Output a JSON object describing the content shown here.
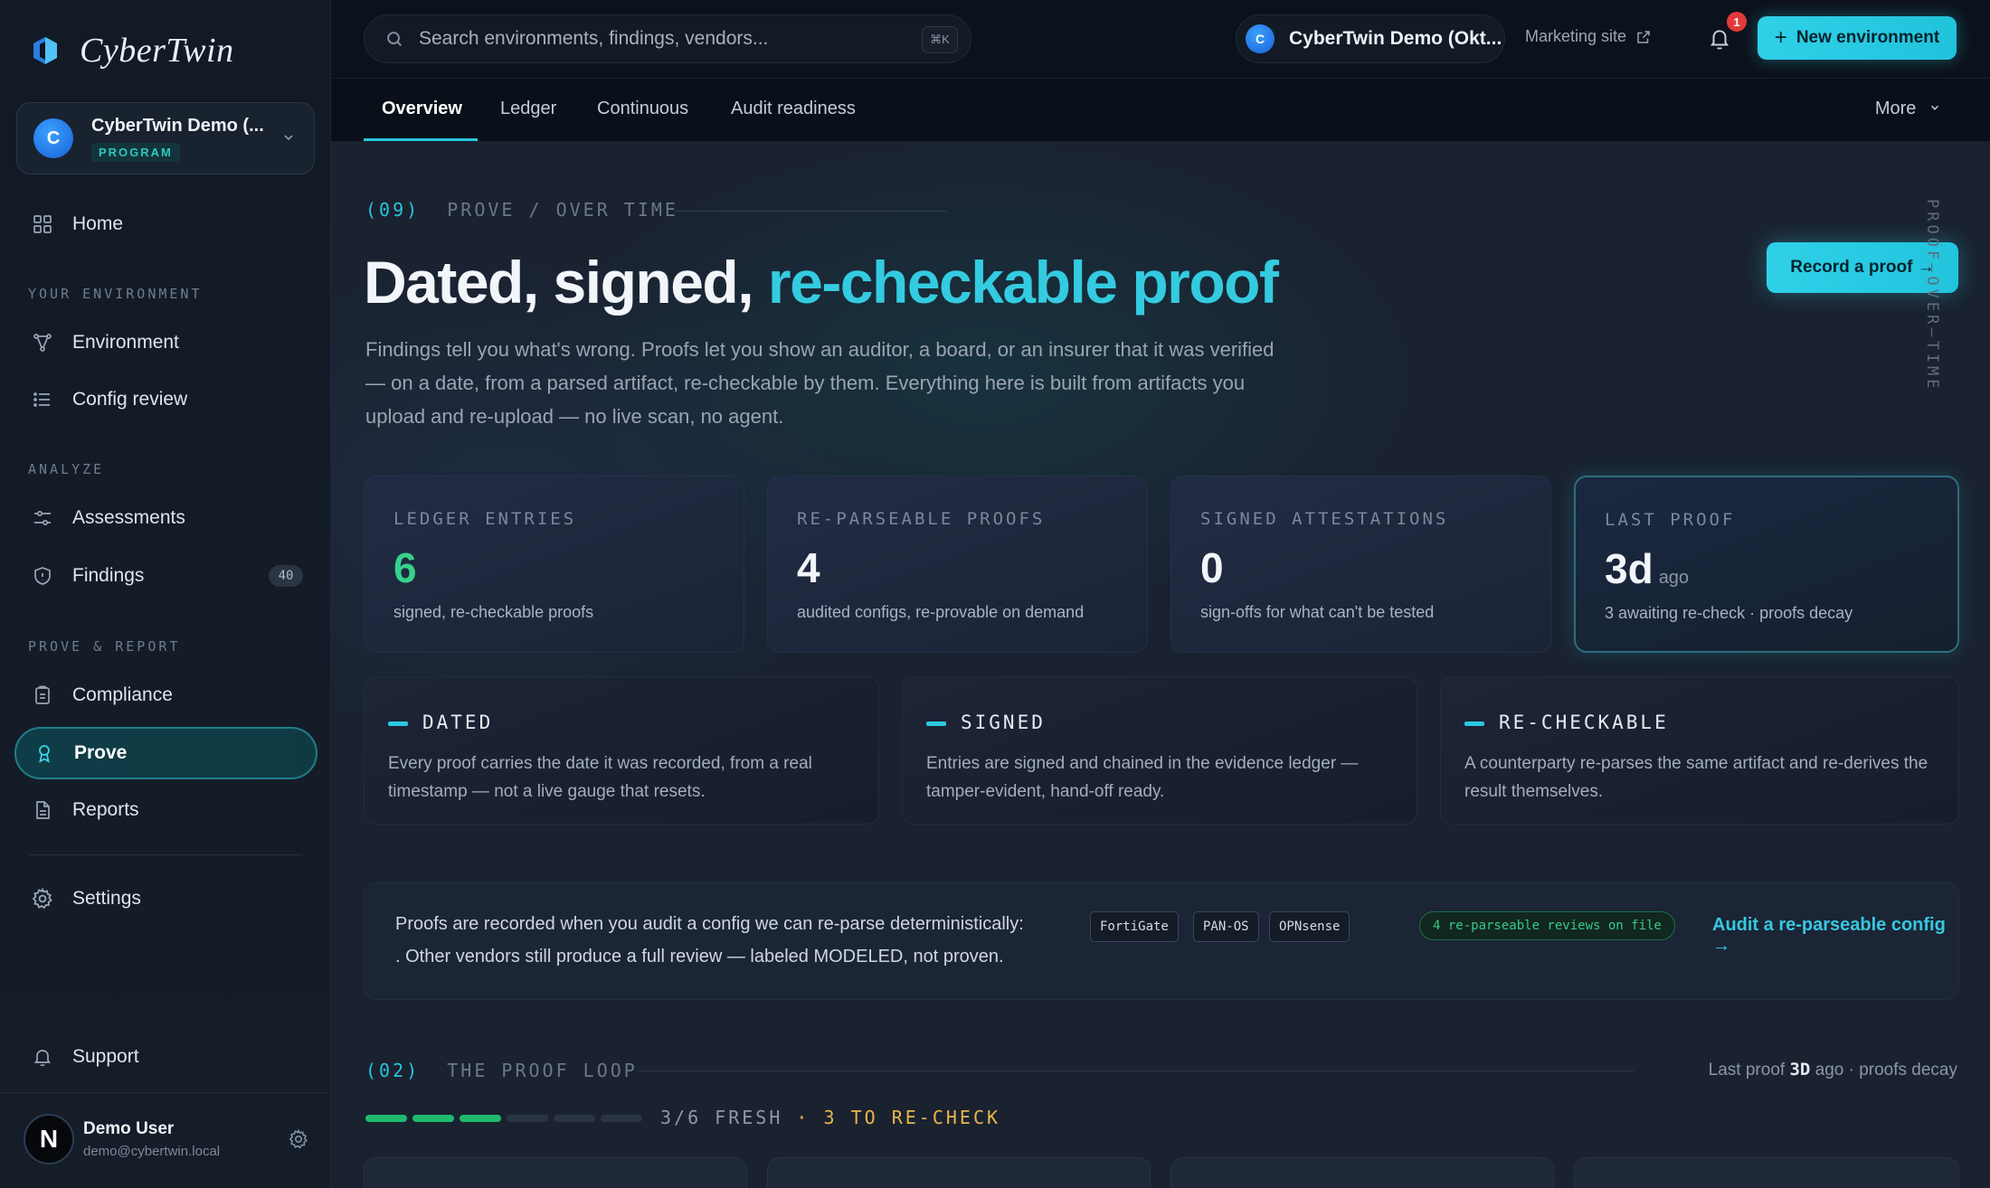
{
  "brand": {
    "name": "CyberTwin"
  },
  "org": {
    "name": "CyberTwin Demo (...",
    "badge": "PROGRAM",
    "initial": "C"
  },
  "nav": {
    "home": "Home",
    "section_env": "YOUR ENVIRONMENT",
    "environment": "Environment",
    "config_review": "Config review",
    "section_analyze": "ANALYZE",
    "assessments": "Assessments",
    "findings": "Findings",
    "findings_count": "40",
    "section_prove": "PROVE & REPORT",
    "compliance": "Compliance",
    "prove": "Prove",
    "reports": "Reports",
    "settings": "Settings",
    "support": "Support"
  },
  "user": {
    "initial": "N",
    "name": "Demo User",
    "email": "demo@cybertwin.local"
  },
  "topbar": {
    "search_placeholder": "Search environments, findings, vendors...",
    "shortcut": "⌘K",
    "env_initial": "C",
    "env_name": "CyberTwin Demo (Okt...",
    "marketing": "Marketing site",
    "notif_count": "1",
    "new_env": "New environment"
  },
  "tabs": [
    "Overview",
    "Ledger",
    "Continuous",
    "Audit readiness"
  ],
  "tabs_more": "More",
  "hero": {
    "eyebrow_num": "(09)",
    "eyebrow_text": "PROVE / OVER TIME",
    "title_plain": "Dated, signed, ",
    "title_accent": "re-checkable proof",
    "lead": "Findings tell you what's wrong. Proofs let you show an auditor, a board, or an insurer that it was verified — on a date, from a parsed artifact, re-checkable by them. Everything here is built from artifacts you upload and re-upload — no live scan, no agent.",
    "record_btn": "Record a proof →",
    "vertical_label": "PROOF—OVER—TIME"
  },
  "stats": [
    {
      "label": "LEDGER ENTRIES",
      "value": "6",
      "sub": "signed, re-checkable proofs"
    },
    {
      "label": "RE-PARSEABLE PROOFS",
      "value": "4",
      "sub": "audited configs, re-provable on demand"
    },
    {
      "label": "SIGNED ATTESTATIONS",
      "value": "0",
      "sub": "sign-offs for what can't be tested"
    },
    {
      "label": "LAST PROOF",
      "value": "3d",
      "ago": "ago",
      "sub": "3 awaiting re-check · proofs decay"
    }
  ],
  "principles": [
    {
      "title": "DATED",
      "text": "Every proof carries the date it was recorded, from a real timestamp — not a live gauge that resets."
    },
    {
      "title": "SIGNED",
      "text": "Entries are signed and chained in the evidence ledger — tamper-evident, hand-off ready."
    },
    {
      "title": "RE-CHECKABLE",
      "text": "A counterparty re-parses the same artifact and re-derives the result themselves."
    }
  ],
  "banner": {
    "text1": "Proofs are recorded when you audit a config we can re-parse deterministically:",
    "vendors": [
      "FortiGate",
      "PAN-OS",
      "OPNsense"
    ],
    "text2": ". Other vendors still produce a full review — labeled MODELED, not proven.",
    "chip": "4 re-parseable reviews on file",
    "link": "Audit a re-parseable config →"
  },
  "loop": {
    "num": "(02)",
    "title": "THE PROOF LOOP",
    "right_prefix": "Last proof",
    "right_value": "3D",
    "right_suffix": "ago · proofs decay",
    "fresh": "3/6 FRESH",
    "dot": "·",
    "recheck": "3 TO RE-CHECK",
    "fresh_count": 3,
    "total": 6
  }
}
